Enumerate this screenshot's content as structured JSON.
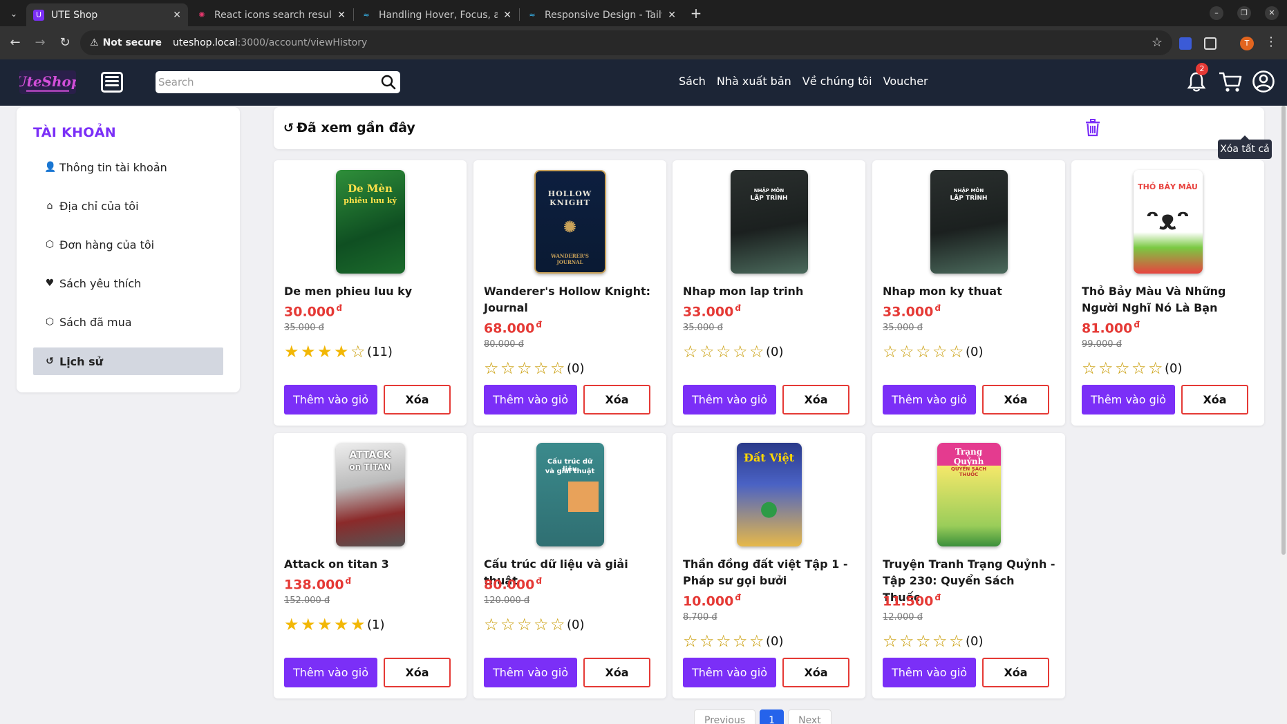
{
  "browser": {
    "tabs": [
      {
        "title": "UTE Shop",
        "active": true
      },
      {
        "title": "React icons search result",
        "active": false
      },
      {
        "title": "Handling Hover, Focus, a",
        "active": false
      },
      {
        "title": "Responsive Design - Tailw",
        "active": false
      }
    ],
    "security": "Not secure",
    "url_host": "uteshop.local",
    "url_path": ":3000/account/viewHistory",
    "profile_initial": "T"
  },
  "header": {
    "search_placeholder": "Search",
    "nav": [
      "Sách",
      "Nhà xuất bản",
      "Về chúng tôi",
      "Voucher"
    ],
    "notification_count": "2"
  },
  "sidebar": {
    "title": "TÀI KHOẢN",
    "items": [
      {
        "label": "Thông tin tài khoản",
        "icon": "user-icon"
      },
      {
        "label": "Địa chỉ của tôi",
        "icon": "home-icon"
      },
      {
        "label": "Đơn hàng của tôi",
        "icon": "box-icon"
      },
      {
        "label": "Sách yêu thích",
        "icon": "heart-icon"
      },
      {
        "label": "Sách đã mua",
        "icon": "box-icon"
      },
      {
        "label": "Lịch sử",
        "icon": "history-icon",
        "active": true
      }
    ]
  },
  "history": {
    "title": "Đã xem gần đây",
    "clear_all_tooltip": "Xóa tất cả",
    "add_label": "Thêm vào giỏ",
    "delete_label": "Xóa",
    "currency": "đ",
    "products": [
      {
        "name": "De men phieu luu ky",
        "price": "30.000",
        "old_price": "35.000",
        "rating": 4,
        "reviews": "(11)"
      },
      {
        "name": "Wanderer's Hollow Knight: Journal",
        "price": "68.000",
        "old_price": "80.000",
        "rating": 0,
        "reviews": "(0)"
      },
      {
        "name": "Nhap mon lap trinh",
        "price": "33.000",
        "old_price": "35.000",
        "rating": 0,
        "reviews": "(0)"
      },
      {
        "name": "Nhap mon ky thuat",
        "price": "33.000",
        "old_price": "35.000",
        "rating": 0,
        "reviews": "(0)"
      },
      {
        "name": "Thỏ Bảy Màu Và Những Người Nghĩ Nó Là Bạn",
        "price": "81.000",
        "old_price": "99.000",
        "rating": 0,
        "reviews": "(0)"
      },
      {
        "name": "Attack on titan 3",
        "price": "138.000",
        "old_price": "152.000",
        "rating": 5,
        "reviews": "(1)"
      },
      {
        "name": "Cấu trúc dữ liệu và giải thuật",
        "price": "80.000",
        "old_price": "120.000",
        "rating": 0,
        "reviews": "(0)"
      },
      {
        "name": "Thần đồng đất việt Tập 1 - Pháp sư gọi bưởi",
        "price": "10.000",
        "old_price": "8.700",
        "rating": 0,
        "reviews": "(0)"
      },
      {
        "name": "Truyện Tranh Trạng Quỷnh - Tập 230: Quyển Sách Thuốc",
        "price": "11.500",
        "old_price": "12.000",
        "rating": 0,
        "reviews": "(0)"
      }
    ]
  },
  "pagination": {
    "prev": "Previous",
    "current": "1",
    "next": "Next"
  }
}
